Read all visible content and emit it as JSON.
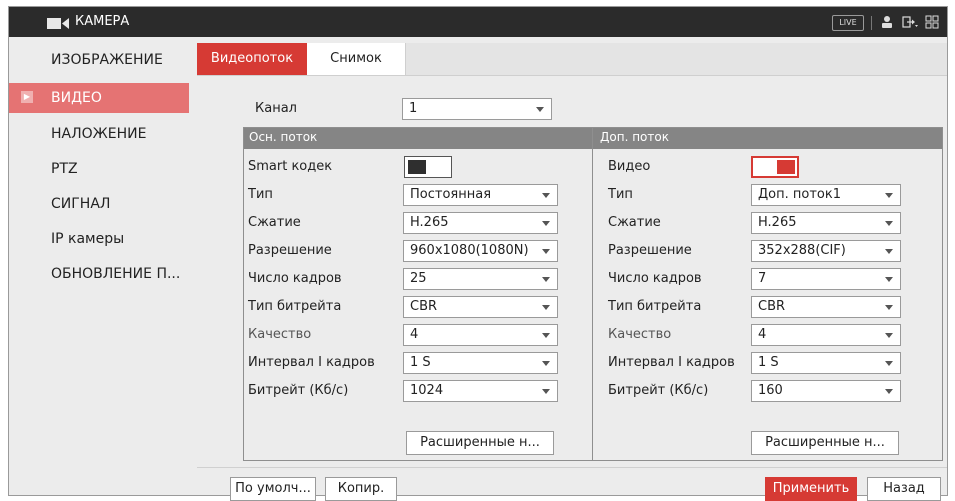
{
  "titlebar": {
    "title": "КАМЕРА",
    "live_label": "LIVE",
    "icons": [
      "camera-icon",
      "user-icon",
      "logout-icon",
      "menu-grid-icon"
    ]
  },
  "sidebar": {
    "items": [
      {
        "label": "ИЗОБРАЖЕНИЕ",
        "active": false
      },
      {
        "label": "ВИДЕО",
        "active": true
      },
      {
        "label": "НАЛОЖЕНИЕ",
        "active": false
      },
      {
        "label": "PTZ",
        "active": false
      },
      {
        "label": "СИГНАЛ",
        "active": false
      },
      {
        "label": "IP камеры",
        "active": false
      },
      {
        "label": "ОБНОВЛЕНИЕ П...",
        "active": false
      }
    ]
  },
  "tabs": [
    {
      "label": "Видеопоток",
      "active": true
    },
    {
      "label": "Снимок",
      "active": false
    }
  ],
  "channel": {
    "label": "Канал",
    "value": "1"
  },
  "main_stream": {
    "title": "Осн. поток",
    "smart_codec": {
      "label": "Smart кодек",
      "enabled": false
    },
    "fields": [
      {
        "label": "Тип",
        "value": "Постоянная"
      },
      {
        "label": "Сжатие",
        "value": "H.265"
      },
      {
        "label": "Разрешение",
        "value": "960x1080(1080N)"
      },
      {
        "label": "Число кадров",
        "value": "25"
      },
      {
        "label": "Тип битрейта",
        "value": "CBR"
      },
      {
        "label": "Качество",
        "value": "4"
      },
      {
        "label": "Интервал I кадров",
        "value": "1 S"
      },
      {
        "label": "Битрейт (Кб/с)",
        "value": "1024"
      }
    ],
    "advanced_button": "Расширенные н..."
  },
  "sub_stream": {
    "title": "Доп. поток",
    "video": {
      "label": "Видео",
      "enabled": true
    },
    "fields": [
      {
        "label": "Тип",
        "value": "Доп. поток1"
      },
      {
        "label": "Сжатие",
        "value": "H.265"
      },
      {
        "label": "Разрешение",
        "value": "352x288(CIF)"
      },
      {
        "label": "Число кадров",
        "value": "7"
      },
      {
        "label": "Тип битрейта",
        "value": "CBR"
      },
      {
        "label": "Качество",
        "value": "4"
      },
      {
        "label": "Интервал I кадров",
        "value": "1 S"
      },
      {
        "label": "Битрейт (Кб/с)",
        "value": "160"
      }
    ],
    "advanced_button": "Расширенные н..."
  },
  "footer": {
    "default_button": "По умолч...",
    "copy_button": "Копир.",
    "apply_button": "Применить",
    "back_button": "Назад"
  },
  "colors": {
    "titlebar": "#2b2b2b",
    "accent": "#d63a34",
    "sidebar_active": "#e57373",
    "group_header": "#858585",
    "background": "#ececec"
  }
}
